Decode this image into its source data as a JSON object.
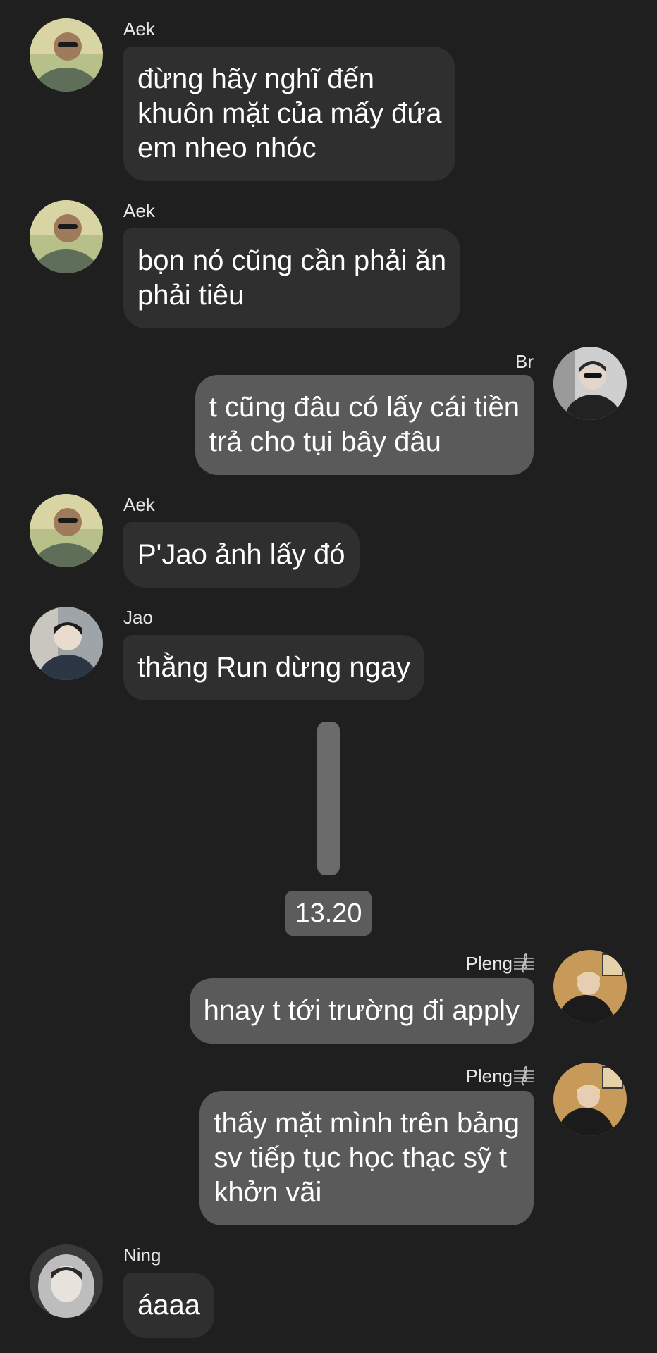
{
  "messages": [
    {
      "sender": "Aek",
      "side": "left",
      "lines": [
        "đừng hãy nghĩ đến",
        "khuôn mặt của mấy đứa",
        "em nheo nhóc"
      ]
    },
    {
      "sender": "Aek",
      "side": "left",
      "lines": [
        "bọn nó cũng cần phải ăn",
        "phải tiêu"
      ]
    },
    {
      "sender": "Br",
      "side": "right",
      "lines": [
        "t cũng đâu có lấy cái tiền",
        "trả cho tụi bây đâu"
      ]
    },
    {
      "sender": "Aek",
      "side": "left",
      "lines": [
        "P'Jao ảnh lấy đó"
      ]
    },
    {
      "sender": "Jao",
      "side": "left",
      "lines": [
        "thằng Run dừng ngay"
      ]
    },
    {
      "sender": "Pleng",
      "side": "right",
      "lines": [
        "hnay t tới trường đi apply"
      ]
    },
    {
      "sender": "Pleng",
      "side": "right",
      "lines": [
        "thấy mặt mình trên bảng",
        "sv tiếp tục học thạc sỹ t",
        "khởn vãi"
      ]
    },
    {
      "sender": "Ning",
      "side": "left",
      "lines": [
        "áaaa"
      ]
    }
  ],
  "divider": {
    "time": "13.20"
  },
  "colors": {
    "background": "#1f1f1f",
    "incoming_bubble": "#2f2f2f",
    "outgoing_bubble": "#5a5a5a",
    "text": "#ffffff"
  }
}
